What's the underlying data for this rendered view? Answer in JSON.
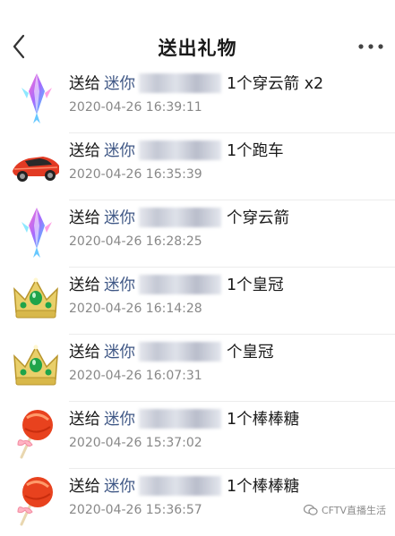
{
  "header": {
    "title": "送出礼物",
    "back_icon": "chevron-left-icon",
    "more_icon": "more-horizontal-icon"
  },
  "gifts": [
    {
      "prefix": "送给",
      "recipient": "迷你",
      "gift": "1个穿云箭 x2",
      "time": "2020-04-26 16:39:11",
      "icon": "arrow-gift-icon"
    },
    {
      "prefix": "送给",
      "recipient": "迷你",
      "gift": "1个跑车",
      "time": "2020-04-26 16:35:39",
      "icon": "sports-car-icon"
    },
    {
      "prefix": "送给",
      "recipient": "迷你",
      "gift": "个穿云箭",
      "time": "2020-04-26 16:28:25",
      "icon": "arrow-gift-icon"
    },
    {
      "prefix": "送给",
      "recipient": "迷你",
      "gift": "1个皇冠",
      "time": "2020-04-26 16:14:28",
      "icon": "crown-icon"
    },
    {
      "prefix": "送给",
      "recipient": "迷你",
      "gift": "个皇冠",
      "time": "2020-04-26 16:07:31",
      "icon": "crown-icon"
    },
    {
      "prefix": "送给",
      "recipient": "迷你",
      "gift": "1个棒棒糖",
      "time": "2020-04-26 15:37:02",
      "icon": "lollipop-icon"
    },
    {
      "prefix": "送给",
      "recipient": "迷你",
      "gift": "1个棒棒糖",
      "time": "2020-04-26 15:36:57",
      "icon": "lollipop-icon"
    }
  ],
  "watermark": {
    "text": "CFTV直播生活"
  },
  "colors": {
    "recipient": "#3f5785",
    "timestamp": "#888888",
    "divider": "#ececec"
  }
}
